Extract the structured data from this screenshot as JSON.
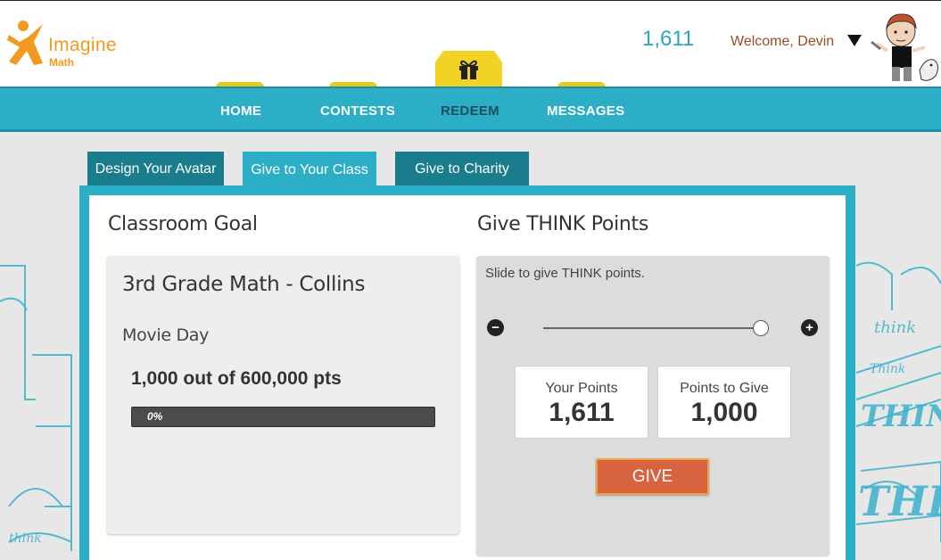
{
  "header": {
    "logo_word": "Imagine",
    "logo_sub": "Math",
    "points_total": "1,611",
    "welcome": "Welcome, Devin"
  },
  "nav": {
    "items": [
      {
        "label": "HOME"
      },
      {
        "label": "CONTESTS"
      },
      {
        "label": "REDEEM"
      },
      {
        "label": "MESSAGES"
      }
    ],
    "active": "REDEEM"
  },
  "subtabs": [
    {
      "label": "Design Your Avatar"
    },
    {
      "label": "Give to Your Class"
    },
    {
      "label": "Give to Charity"
    }
  ],
  "classroom_goal": {
    "title": "Classroom Goal",
    "class_name": "3rd Grade Math - Collins",
    "goal_name": "Movie Day",
    "progress_text": "1,000 out of 600,000 pts",
    "progress_percent_label": "0%",
    "progress_fraction": 0
  },
  "give_points": {
    "title": "Give THINK Points",
    "slide_hint": "Slide to give THINK points.",
    "slider_fraction": 1.0,
    "your_points_label": "Your Points",
    "your_points_value": "1,611",
    "points_to_give_label": "Points to Give",
    "points_to_give_value": "1,000",
    "give_button": "GIVE"
  },
  "colors": {
    "brand_teal": "#2baec6",
    "dark_teal": "#1a7d8d",
    "logo_orange": "#f29a1f",
    "give_orange": "#d8643f"
  }
}
